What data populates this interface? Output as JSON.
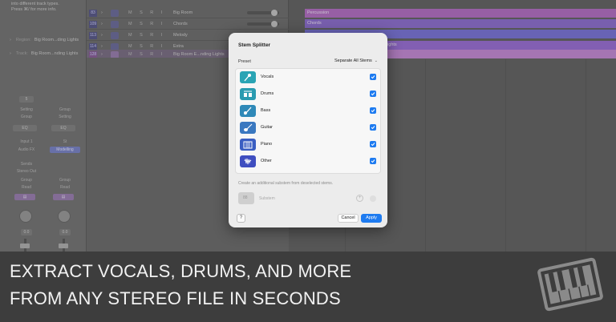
{
  "inspector": {
    "info_lines": [
      "into different track types.",
      "Press ⌘/ for more info."
    ],
    "region_label": "Region:",
    "region_name": "Big Room...ding Lights",
    "track_label": "Track:",
    "track_name": "Big Room...nding Lights",
    "strip_a": {
      "top_value": "5",
      "setting": "Setting",
      "group": "Group",
      "eq": "EQ",
      "input": "Input 1",
      "plugin": "Audio FX",
      "send": "Sends",
      "output": "Stereo Out",
      "mode": "Group",
      "read": "Read",
      "pan_value": "0.0",
      "vol_value": "0.6"
    },
    "strip_b": {
      "group": "Group",
      "setting": "Setting",
      "eq": "EQ",
      "input": "St",
      "plugin": "Modelling",
      "mode": "Group",
      "read": "Read",
      "pan_value": "0.0",
      "vol_value": "0.0"
    }
  },
  "tracks": [
    {
      "num": "83",
      "name": "Big Room"
    },
    {
      "num": "109",
      "name": "Chords"
    },
    {
      "num": "113",
      "name": "Melody"
    },
    {
      "num": "114",
      "name": "Extra"
    },
    {
      "num": "128",
      "name": "Big Room E...nding Lights"
    }
  ],
  "track_buttons": "M S R I",
  "clips": [
    {
      "label": "Percussion",
      "color": "#b46fc4"
    },
    {
      "label": "Chords",
      "color": "#8e6fd0"
    },
    {
      "label": "",
      "color": "#7a74d8"
    },
    {
      "label": "Lights",
      "color": "#9a6fd6"
    },
    {
      "label": "",
      "color": "#c58ad6"
    }
  ],
  "modal": {
    "title": "Stem Splitter",
    "preset_label": "Preset",
    "preset_value": "Separate All Stems",
    "stems": [
      {
        "name": "Vocals",
        "color": "#2aa4b4",
        "icon": "microphone-icon",
        "checked": true
      },
      {
        "name": "Drums",
        "color": "#2a9bb0",
        "icon": "drums-icon",
        "checked": true
      },
      {
        "name": "Bass",
        "color": "#2f89b8",
        "icon": "bass-guitar-icon",
        "checked": true
      },
      {
        "name": "Guitar",
        "color": "#3a78c0",
        "icon": "guitar-icon",
        "checked": true
      },
      {
        "name": "Piano",
        "color": "#3a5ec2",
        "icon": "piano-icon",
        "checked": true
      },
      {
        "name": "Other",
        "color": "#3f4ec0",
        "icon": "waveform-icon",
        "checked": true
      }
    ],
    "hint": "Create an additional substem from deselected stems.",
    "substem_icon_text": "88",
    "substem_label": "Substem",
    "help_label": "?",
    "cancel_label": "Cancel",
    "apply_label": "Apply"
  },
  "banner": {
    "line1": "EXTRACT VOCALS, DRUMS, AND MORE",
    "line2": "FROM ANY STEREO FILE IN SECONDS",
    "logo": "piano-keys-logo"
  },
  "colors": {
    "accent": "#1e7bf0",
    "banner_bg": "#3d3d3d",
    "banner_text": "#f2f2f2"
  }
}
